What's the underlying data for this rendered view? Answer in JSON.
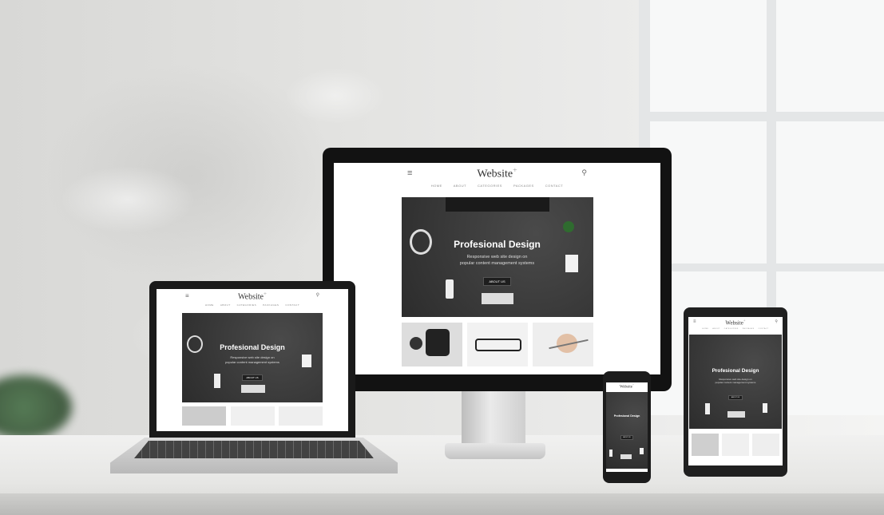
{
  "site": {
    "brand": "Website",
    "brand_mark": "+",
    "nav": [
      "HOME",
      "ABOUT",
      "CATEGORIES",
      "PACKAGES",
      "CONTACT"
    ],
    "hero_title": "Profesional Design",
    "hero_subtitle_line1": "Responsive web site design on",
    "hero_subtitle_line2": "popular content management systems",
    "hero_button": "ABOUT US"
  },
  "colors": {
    "device_frame": "#121212",
    "hero_bg": "#3a3a3a",
    "desk": "#e6e6e4",
    "wall": "#e0e0de"
  },
  "icons": [
    "menu-icon",
    "search-icon"
  ]
}
